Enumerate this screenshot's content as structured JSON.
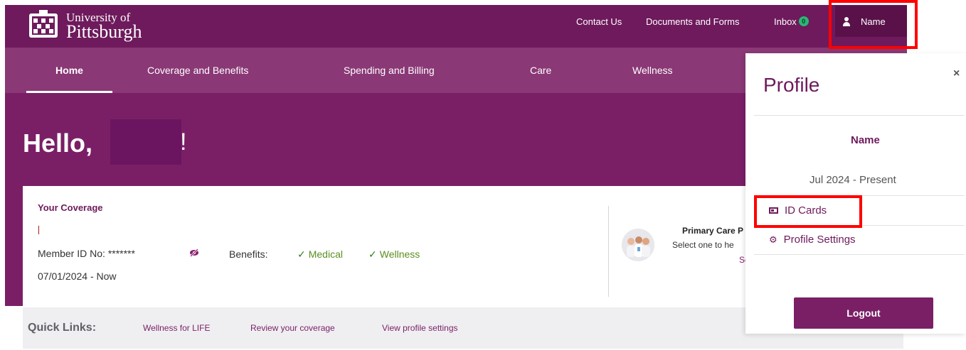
{
  "header": {
    "logo_line1": "University of",
    "logo_line2": "Pittsburgh",
    "contact": "Contact Us",
    "documents": "Documents and Forms",
    "inbox": "Inbox",
    "inbox_count": "0",
    "user_name": "Name"
  },
  "nav": {
    "home": "Home",
    "coverage": "Coverage and Benefits",
    "spending": "Spending and Billing",
    "care": "Care",
    "wellness": "Wellness"
  },
  "hero": {
    "greeting": "Hello,",
    "exclaim": "!"
  },
  "coverage": {
    "title": "Your Coverage",
    "member_label": "Member ID No:",
    "member_value": "*******",
    "benefits_label": "Benefits:",
    "benefit_medical": "Medical",
    "benefit_wellness": "Wellness",
    "check": "✓",
    "date_range": "07/01/2024 - Now"
  },
  "pcp": {
    "title": "Primary Care P",
    "subtitle": "Select one to he",
    "link": "Se"
  },
  "quick_links": {
    "title": "Quick Links:",
    "items": [
      "Wellness for LIFE",
      "Review your coverage",
      "View profile settings"
    ]
  },
  "profile": {
    "title": "Profile",
    "close": "×",
    "name": "Name",
    "date_range": "Jul 2024 - Present",
    "id_cards": "ID Cards",
    "settings": "Profile Settings",
    "logout": "Logout"
  },
  "colors": {
    "brand_purple": "#6e1a5c",
    "nav_purple": "#8a3876",
    "highlight_red": "#ff0000",
    "check_green": "#5a8f1f"
  }
}
